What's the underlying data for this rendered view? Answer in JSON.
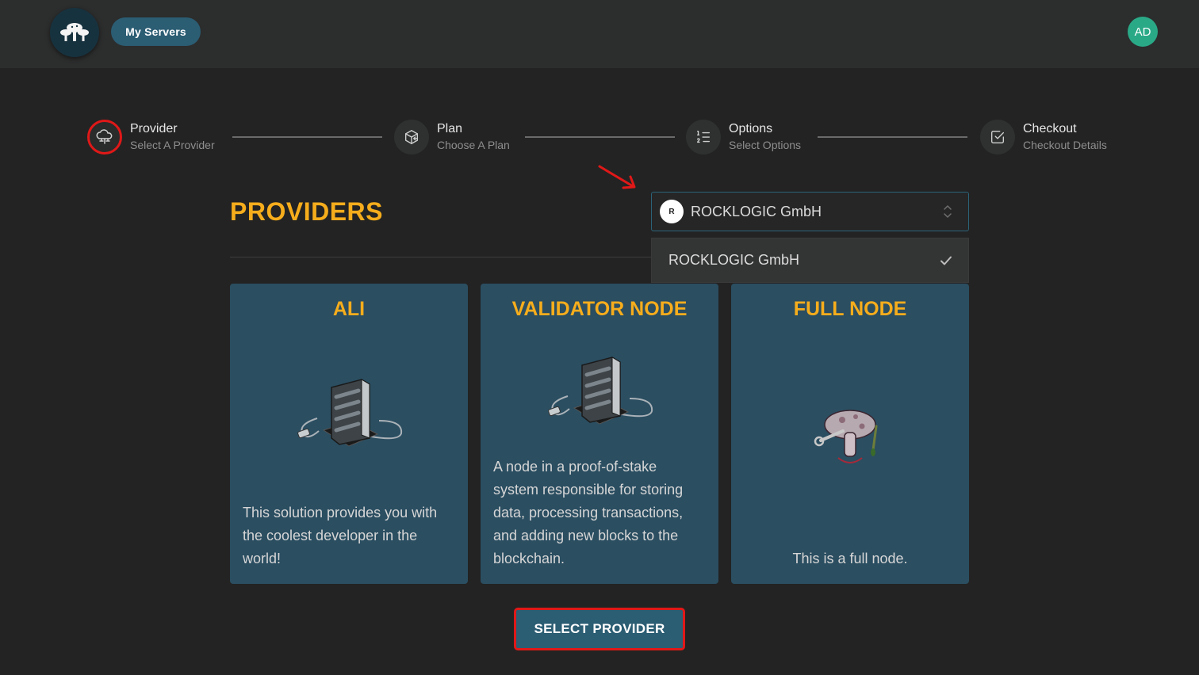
{
  "header": {
    "nav_button": "My Servers",
    "avatar_initials": "AD"
  },
  "stepper": [
    {
      "title": "Provider",
      "subtitle": "Select A Provider",
      "active": true,
      "icon": "cloud-network-icon"
    },
    {
      "title": "Plan",
      "subtitle": "Choose A Plan",
      "active": false,
      "icon": "package-icon"
    },
    {
      "title": "Options",
      "subtitle": "Select Options",
      "active": false,
      "icon": "list-numbers-icon"
    },
    {
      "title": "Checkout",
      "subtitle": "Checkout Details",
      "active": false,
      "icon": "checkbox-icon"
    }
  ],
  "main": {
    "title": "PROVIDERS",
    "provider_select": {
      "selected": "ROCKLOGIC GmbH",
      "logo_text": "R",
      "options": [
        {
          "label": "ROCKLOGIC GmbH",
          "checked": true
        }
      ]
    },
    "cards": [
      {
        "title": "ALI",
        "description": "This solution provides you with the coolest developer in the world!"
      },
      {
        "title": "VALIDATOR NODE",
        "description": "A node in a proof-of-stake system responsible for storing data, processing transactions, and adding new blocks to the blockchain."
      },
      {
        "title": "FULL NODE",
        "description": "This is a full node."
      }
    ],
    "submit_label": "SELECT PROVIDER"
  },
  "colors": {
    "accent_gold": "#f6ad1c",
    "card_bg": "#2b4e61",
    "button_bg": "#2b5d73",
    "highlight_red": "#e01818",
    "avatar_green": "#2aa987"
  }
}
